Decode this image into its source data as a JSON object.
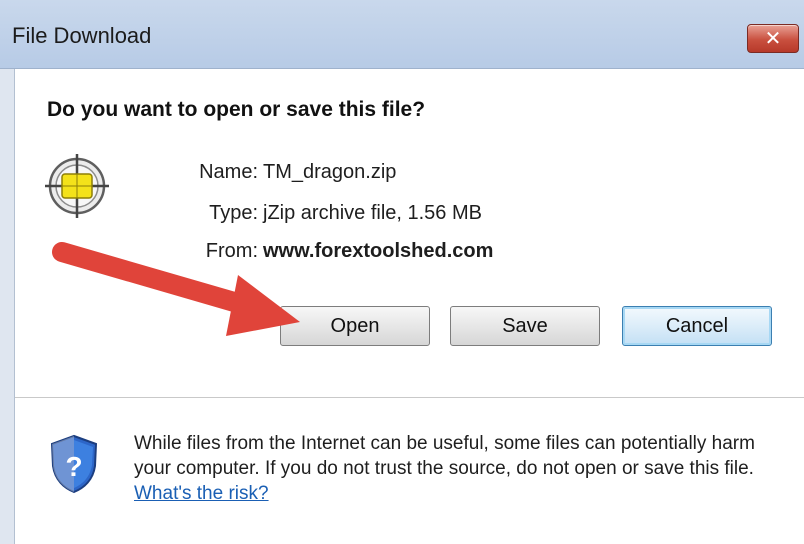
{
  "window": {
    "title": "File Download",
    "close_glyph": "✕"
  },
  "dialog": {
    "question": "Do you want to open or save this file?",
    "file_icon": "file-type-icon",
    "name_label": "Name:",
    "name_value": "TM_dragon.zip",
    "type_label": "Type:",
    "type_value": "jZip archive file, 1.56 MB",
    "from_label": "From:",
    "from_value": "www.forextoolshed.com"
  },
  "buttons": {
    "open": "Open",
    "save": "Save",
    "cancel": "Cancel"
  },
  "security": {
    "shield_icon": "security-shield-icon",
    "warning_text": "While files from the Internet can be useful, some files can potentially harm your computer. If you do not trust the source, do not open or save this file.",
    "risk_link": "What's the risk?"
  },
  "annotation": {
    "arrow_color": "#e0443a"
  }
}
